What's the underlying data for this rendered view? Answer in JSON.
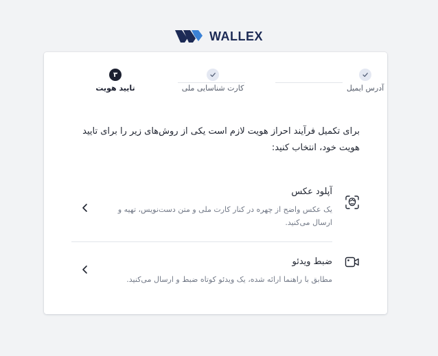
{
  "brand": {
    "name": "WALLEX",
    "color": "#1c2a55"
  },
  "stepper": {
    "steps": [
      {
        "label": "آدرس ایمیل",
        "state": "done",
        "icon": "check-icon"
      },
      {
        "label": "کارت شناسایی ملی",
        "state": "done",
        "icon": "check-icon"
      },
      {
        "label": "تایید هویت",
        "state": "active",
        "number": "۳"
      }
    ]
  },
  "instruction": "برای تکمیل فرآیند احراز هویت لازم است یکی از روش‌های زیر را برای تایید هویت خود، انتخاب کنید:",
  "options": [
    {
      "title": "آپلود عکس",
      "description": "یک عکس واضح از چهره در کنار کارت ملی و متن دست‌نویس، تهیه و ارسال می‌کنید.",
      "icon": "face-scan-icon"
    },
    {
      "title": "ضبط ویدئو",
      "description": "مطابق با راهنما ارائه شده، یک ویدئو کوتاه ضبط و ارسال می‌کنید.",
      "icon": "video-camera-icon"
    }
  ]
}
